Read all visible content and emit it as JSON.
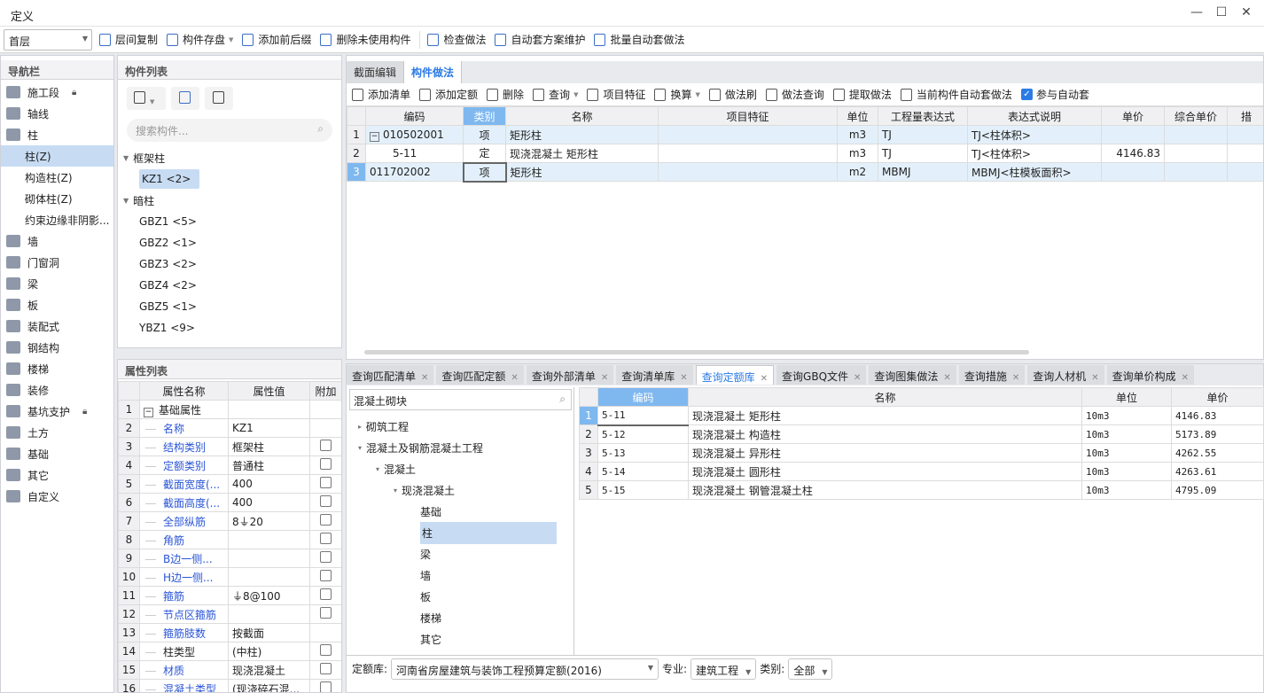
{
  "window": {
    "title": "定义",
    "controls": [
      "—",
      "☐",
      "✕"
    ]
  },
  "toolbar": {
    "floor": "首层",
    "items": [
      "层间复制",
      "构件存盘",
      "添加前后缀",
      "删除未使用构件",
      "检查做法",
      "自动套方案维护",
      "批量自动套做法"
    ]
  },
  "nav": {
    "title": "导航栏",
    "items": [
      {
        "label": "施工段",
        "lock": true
      },
      {
        "label": "轴线"
      },
      {
        "label": "柱"
      },
      {
        "label": "柱(Z)",
        "sub": true,
        "selected": true
      },
      {
        "label": "构造柱(Z)",
        "sub": true
      },
      {
        "label": "砌体柱(Z)",
        "sub": true
      },
      {
        "label": "约束边缘非阴影...",
        "sub": true
      },
      {
        "label": "墙"
      },
      {
        "label": "门窗洞"
      },
      {
        "label": "梁"
      },
      {
        "label": "板"
      },
      {
        "label": "装配式"
      },
      {
        "label": "钢结构"
      },
      {
        "label": "楼梯"
      },
      {
        "label": "装修"
      },
      {
        "label": "基坑支护",
        "lock": true
      },
      {
        "label": "土方"
      },
      {
        "label": "基础"
      },
      {
        "label": "其它"
      },
      {
        "label": "自定义"
      }
    ]
  },
  "components": {
    "title": "构件列表",
    "search_placeholder": "搜索构件...",
    "groups": [
      {
        "label": "框架柱",
        "items": [
          {
            "label": "KZ1 <2>",
            "selected": true
          }
        ]
      },
      {
        "label": "暗柱",
        "items": [
          {
            "label": "GBZ1 <5>"
          },
          {
            "label": "GBZ2 <1>"
          },
          {
            "label": "GBZ3 <2>"
          },
          {
            "label": "GBZ4 <2>"
          },
          {
            "label": "GBZ5 <1>"
          },
          {
            "label": "YBZ1 <9>"
          }
        ]
      }
    ]
  },
  "properties": {
    "title": "属性列表",
    "headers": [
      "属性名称",
      "属性值",
      "附加"
    ],
    "rows": [
      {
        "n": "1",
        "name": "基础属性",
        "value": "",
        "group": true
      },
      {
        "n": "2",
        "name": "名称",
        "value": "KZ1",
        "blue": true,
        "cb": false
      },
      {
        "n": "3",
        "name": "结构类别",
        "value": "框架柱",
        "blue": true,
        "cb": true
      },
      {
        "n": "4",
        "name": "定额类别",
        "value": "普通柱",
        "blue": true,
        "cb": true
      },
      {
        "n": "5",
        "name": "截面宽度(...",
        "value": "400",
        "blue": true,
        "cb": true
      },
      {
        "n": "6",
        "name": "截面高度(...",
        "value": "400",
        "blue": true,
        "cb": true
      },
      {
        "n": "7",
        "name": "全部纵筋",
        "value": "8⏚20",
        "blue": true,
        "cb": true
      },
      {
        "n": "8",
        "name": "角筋",
        "value": "",
        "blue": true,
        "cb": true
      },
      {
        "n": "9",
        "name": "B边一侧...",
        "value": "",
        "blue": true,
        "cb": true
      },
      {
        "n": "10",
        "name": "H边一侧...",
        "value": "",
        "blue": true,
        "cb": true
      },
      {
        "n": "11",
        "name": "箍筋",
        "value": "⏚8@100",
        "blue": true,
        "cb": true
      },
      {
        "n": "12",
        "name": "节点区箍筋",
        "value": "",
        "blue": true,
        "cb": true
      },
      {
        "n": "13",
        "name": "箍筋肢数",
        "value": "按截面",
        "blue": true,
        "cb": false
      },
      {
        "n": "14",
        "name": "柱类型",
        "value": "(中柱)",
        "blue": false,
        "cb": true
      },
      {
        "n": "15",
        "name": "材质",
        "value": "现浇混凝土",
        "blue": true,
        "cb": true
      },
      {
        "n": "16",
        "name": "混凝土类型",
        "value": "(现浇碎石混...",
        "blue": true,
        "cb": true
      }
    ]
  },
  "work": {
    "tabs": [
      "截面编辑",
      "构件做法"
    ],
    "active_tab": 1,
    "toolbar": [
      "添加清单",
      "添加定额",
      "删除",
      "查询",
      "项目特征",
      "换算",
      "做法刷",
      "做法查询",
      "提取做法",
      "当前构件自动套做法"
    ],
    "auto_label": "参与自动套",
    "auto_checked": true,
    "headers": [
      "编码",
      "类别",
      "名称",
      "项目特征",
      "单位",
      "工程量表达式",
      "表达式说明",
      "单价",
      "综合单价",
      "措"
    ],
    "rows": [
      {
        "n": "1",
        "code": "010502001",
        "type": "项",
        "name": "矩形柱",
        "feature": "",
        "unit": "m3",
        "expr": "TJ",
        "desc": "TJ<柱体积>",
        "price": "",
        "total": ""
      },
      {
        "n": "2",
        "code": "5-11",
        "type": "定",
        "name": "现浇混凝土 矩形柱",
        "feature": "",
        "unit": "m3",
        "expr": "TJ",
        "desc": "TJ<柱体积>",
        "price": "4146.83",
        "total": ""
      },
      {
        "n": "3",
        "code": "011702002",
        "type": "项",
        "name": "矩形柱",
        "feature": "",
        "unit": "m2",
        "expr": "MBMJ",
        "desc": "MBMJ<柱模板面积>",
        "price": "",
        "total": ""
      }
    ]
  },
  "query": {
    "tabs": [
      "查询匹配清单",
      "查询匹配定额",
      "查询外部清单",
      "查询清单库",
      "查询定额库",
      "查询GBQ文件",
      "查询图集做法",
      "查询措施",
      "查询人材机",
      "查询单价构成"
    ],
    "active_tab": 4,
    "search_value": "混凝土砌块",
    "tree": [
      {
        "label": "砌筑工程",
        "level": 0,
        "arrow": "▸"
      },
      {
        "label": "混凝土及钢筋混凝土工程",
        "level": 0,
        "arrow": "▾"
      },
      {
        "label": "混凝土",
        "level": 1,
        "arrow": "▾"
      },
      {
        "label": "现浇混凝土",
        "level": 2,
        "arrow": "▾"
      },
      {
        "label": "基础",
        "level": 3
      },
      {
        "label": "柱",
        "level": 3,
        "selected": true
      },
      {
        "label": "梁",
        "level": 3
      },
      {
        "label": "墙",
        "level": 3
      },
      {
        "label": "板",
        "level": 3
      },
      {
        "label": "楼梯",
        "level": 3
      },
      {
        "label": "其它",
        "level": 3
      }
    ],
    "headers": [
      "编码",
      "名称",
      "单位",
      "单价"
    ],
    "rows": [
      {
        "n": "1",
        "code": "5-11",
        "name": "现浇混凝土 矩形柱",
        "unit": "10m3",
        "price": "4146.83"
      },
      {
        "n": "2",
        "code": "5-12",
        "name": "现浇混凝土 构造柱",
        "unit": "10m3",
        "price": "5173.89"
      },
      {
        "n": "3",
        "code": "5-13",
        "name": "现浇混凝土 异形柱",
        "unit": "10m3",
        "price": "4262.55"
      },
      {
        "n": "4",
        "code": "5-14",
        "name": "现浇混凝土 圆形柱",
        "unit": "10m3",
        "price": "4263.61"
      },
      {
        "n": "5",
        "code": "5-15",
        "name": "现浇混凝土 钢管混凝土柱",
        "unit": "10m3",
        "price": "4795.09"
      }
    ],
    "footer": {
      "lib_label": "定额库:",
      "lib_value": "河南省房屋建筑与装饰工程预算定额(2016)",
      "major_label": "专业:",
      "major_value": "建筑工程",
      "cat_label": "类别:",
      "cat_value": "全部"
    }
  },
  "colors": {
    "accent": "#2c7be5",
    "selected": "#c7dcf3",
    "row_highlight": "#e3f0fb"
  }
}
